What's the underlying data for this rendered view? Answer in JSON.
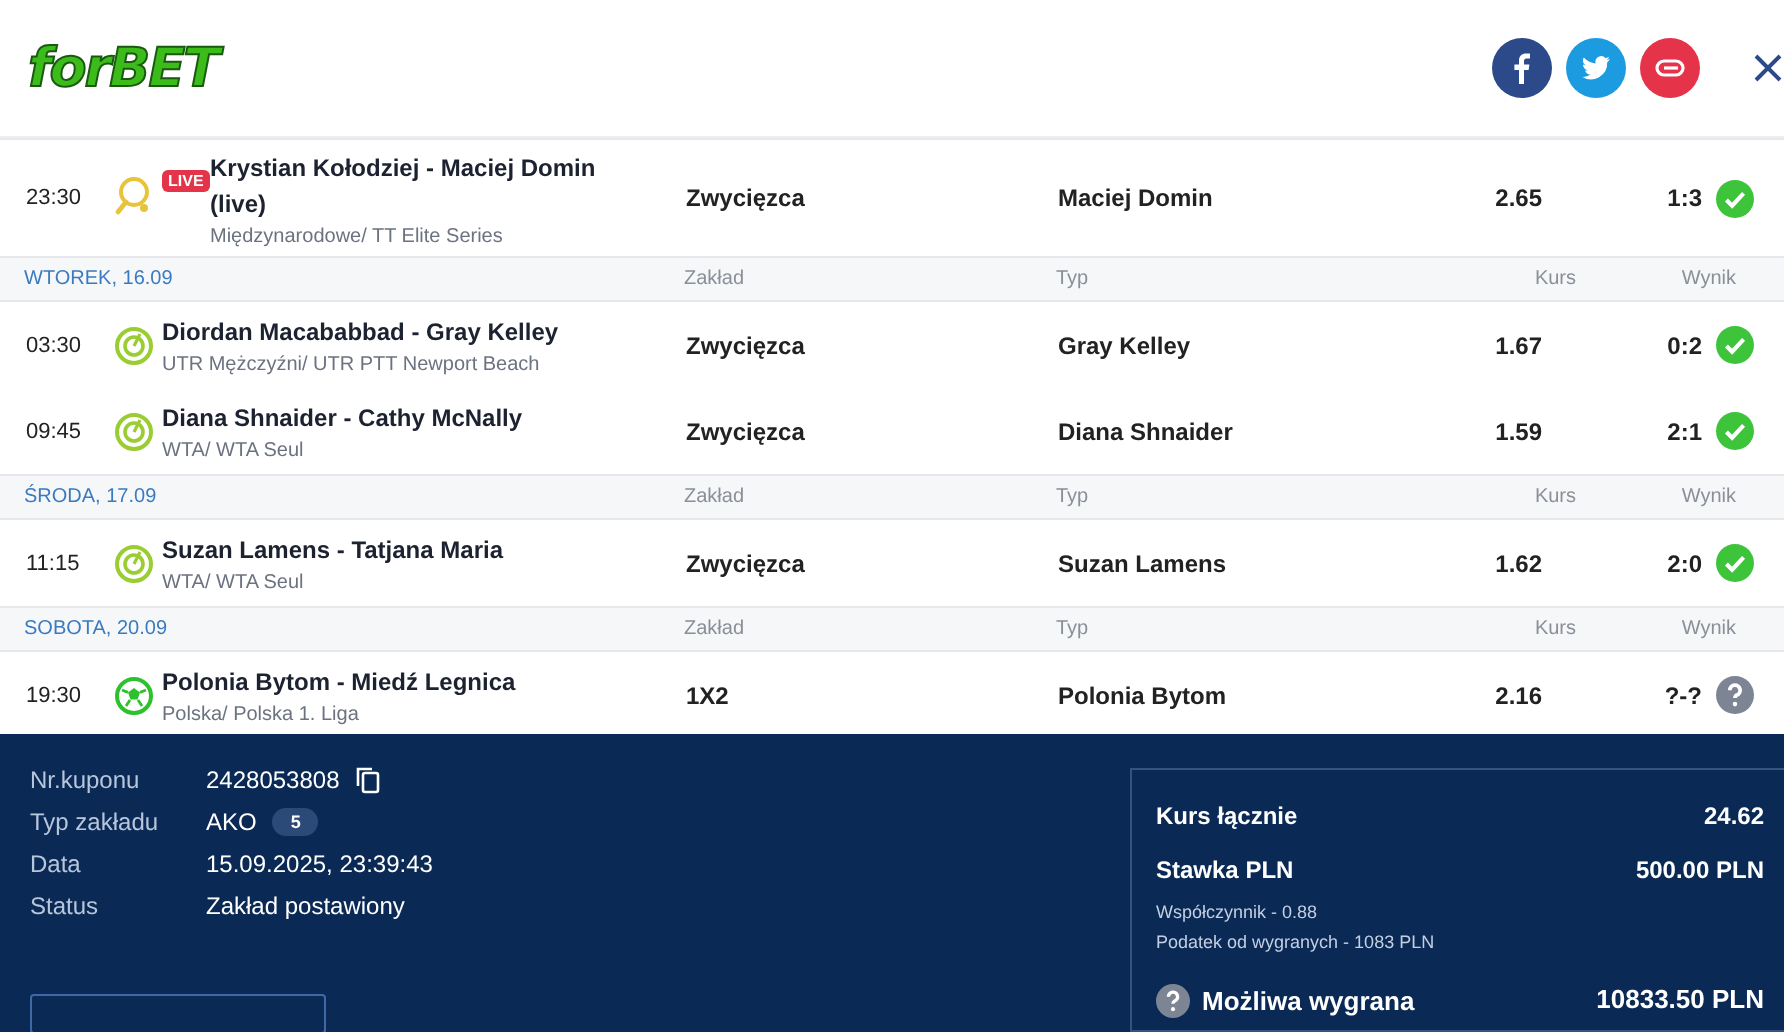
{
  "logo": {
    "part1": "for",
    "part2": "BET"
  },
  "share_buttons": [
    {
      "kind": "facebook"
    },
    {
      "kind": "twitter"
    },
    {
      "kind": "link"
    }
  ],
  "groups": [
    {
      "rows": [
        {
          "time": "23:30",
          "kind": "table-tennis",
          "live": true,
          "live_label": "LIVE",
          "match": "Krystian Kołodziej - Maciej Domin (live)",
          "league": "Międzynarodowe/ TT Elite Series",
          "bet": "Zwycięzca",
          "pick": "Maciej Domin",
          "odds": "2.65",
          "result": "1:3",
          "won": true
        }
      ]
    },
    {
      "date": "WTOREK, 16.09",
      "headers": [
        "Zakład",
        "Typ",
        "Kurs",
        "Wynik"
      ],
      "rows": [
        {
          "time": "03:30",
          "kind": "tennis",
          "live": false,
          "match": "Diordan Macababbad - Gray Kelley",
          "league": "UTR Mężczyźni/ UTR PTT Newport Beach",
          "bet": "Zwycięzca",
          "pick": "Gray Kelley",
          "odds": "1.67",
          "result": "0:2",
          "won": true
        },
        {
          "time": "09:45",
          "kind": "tennis",
          "live": false,
          "match": "Diana Shnaider - Cathy McNally",
          "league": "WTA/ WTA Seul",
          "bet": "Zwycięzca",
          "pick": "Diana Shnaider",
          "odds": "1.59",
          "result": "2:1",
          "won": true
        }
      ]
    },
    {
      "date": "ŚRODA, 17.09",
      "headers": [
        "Zakład",
        "Typ",
        "Kurs",
        "Wynik"
      ],
      "rows": [
        {
          "time": "11:15",
          "kind": "tennis",
          "live": false,
          "match": "Suzan Lamens - Tatjana Maria",
          "league": "WTA/ WTA Seul",
          "bet": "Zwycięzca",
          "pick": "Suzan Lamens",
          "odds": "1.62",
          "result": "2:0",
          "won": true
        }
      ]
    },
    {
      "date": "SOBOTA, 20.09",
      "headers": [
        "Zakład",
        "Typ",
        "Kurs",
        "Wynik"
      ],
      "rows": [
        {
          "time": "19:30",
          "kind": "football",
          "live": false,
          "match": "Polonia Bytom - Miedź Legnica",
          "league": "Polska/ Polska 1. Liga",
          "bet": "1X2",
          "pick": "Polonia Bytom",
          "odds": "2.16",
          "result": "?-?",
          "won": false
        }
      ]
    }
  ],
  "coupon": [
    {
      "label": "Nr.kuponu",
      "value": "2428053808",
      "kind": "copy"
    },
    {
      "label": "Typ zakładu",
      "value": "AKO",
      "kind": "badge",
      "badge": "5"
    },
    {
      "label": "Data",
      "value": "15.09.2025, 23:39:43",
      "kind": "text"
    },
    {
      "label": "Status",
      "value": "Zakład postawiony",
      "kind": "text"
    }
  ],
  "summary": {
    "total_odds_label": "Kurs łącznie",
    "total_odds": "24.62",
    "stake_label": "Stawka PLN",
    "stake": "500.00 PLN",
    "notes": [
      "Współczynnik - 0.88",
      "Podatek od wygranych - 1083 PLN"
    ],
    "win_label": "Możliwa wygrana",
    "win": "10833.50 PLN"
  }
}
